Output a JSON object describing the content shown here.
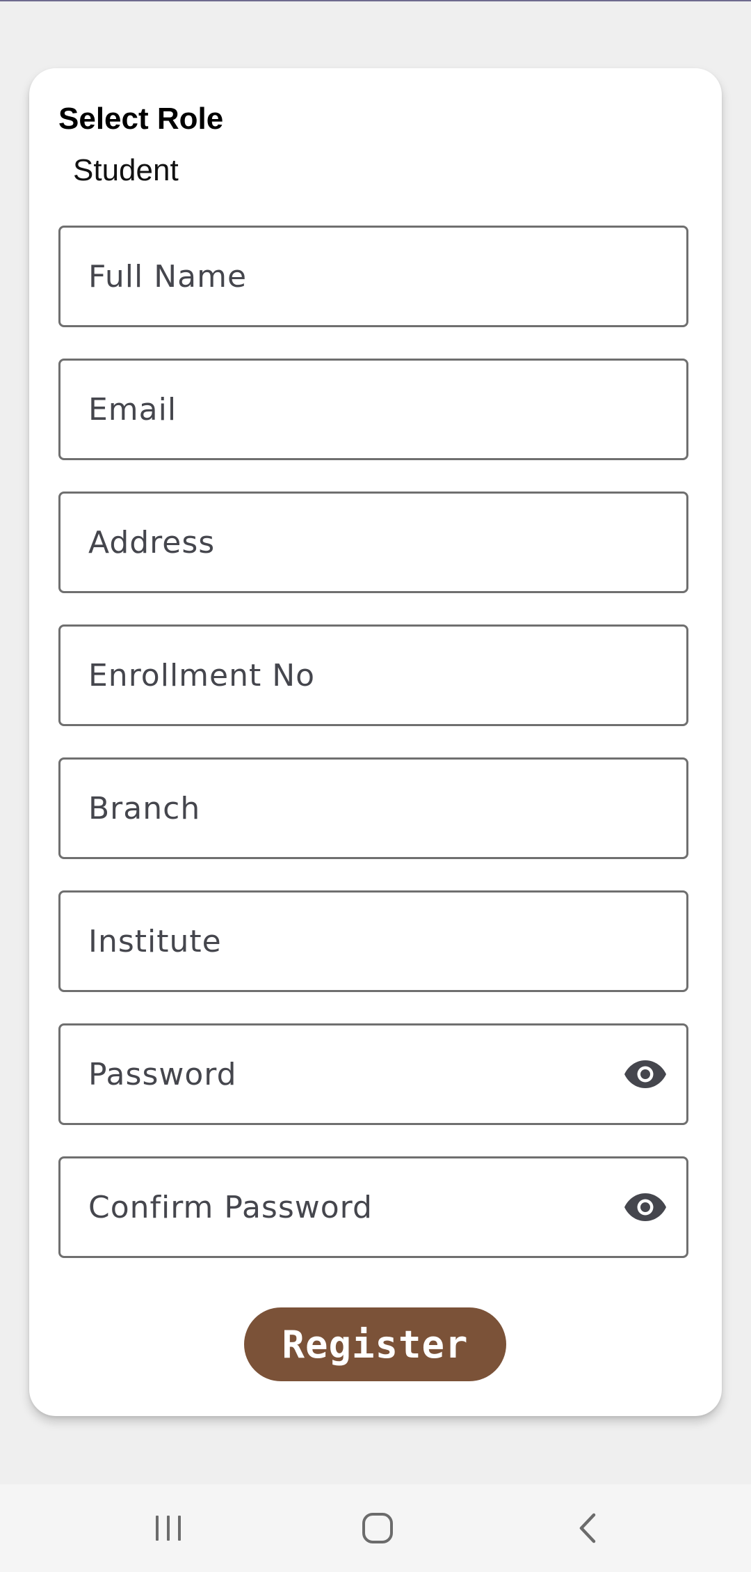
{
  "role": {
    "title": "Select Role",
    "value": "Student"
  },
  "fields": {
    "full_name": "Full Name",
    "email": "Email",
    "address": "Address",
    "enrollment_no": "Enrollment No",
    "branch": "Branch",
    "institute": "Institute",
    "password": "Password",
    "confirm_password": "Confirm Password"
  },
  "register": {
    "label": "Register",
    "color": "#7b5238"
  },
  "icons": {
    "password_toggle": "eye-icon",
    "confirm_password_toggle": "eye-icon",
    "nav_recent": "recent-apps-icon",
    "nav_home": "home-icon",
    "nav_back": "back-icon"
  }
}
